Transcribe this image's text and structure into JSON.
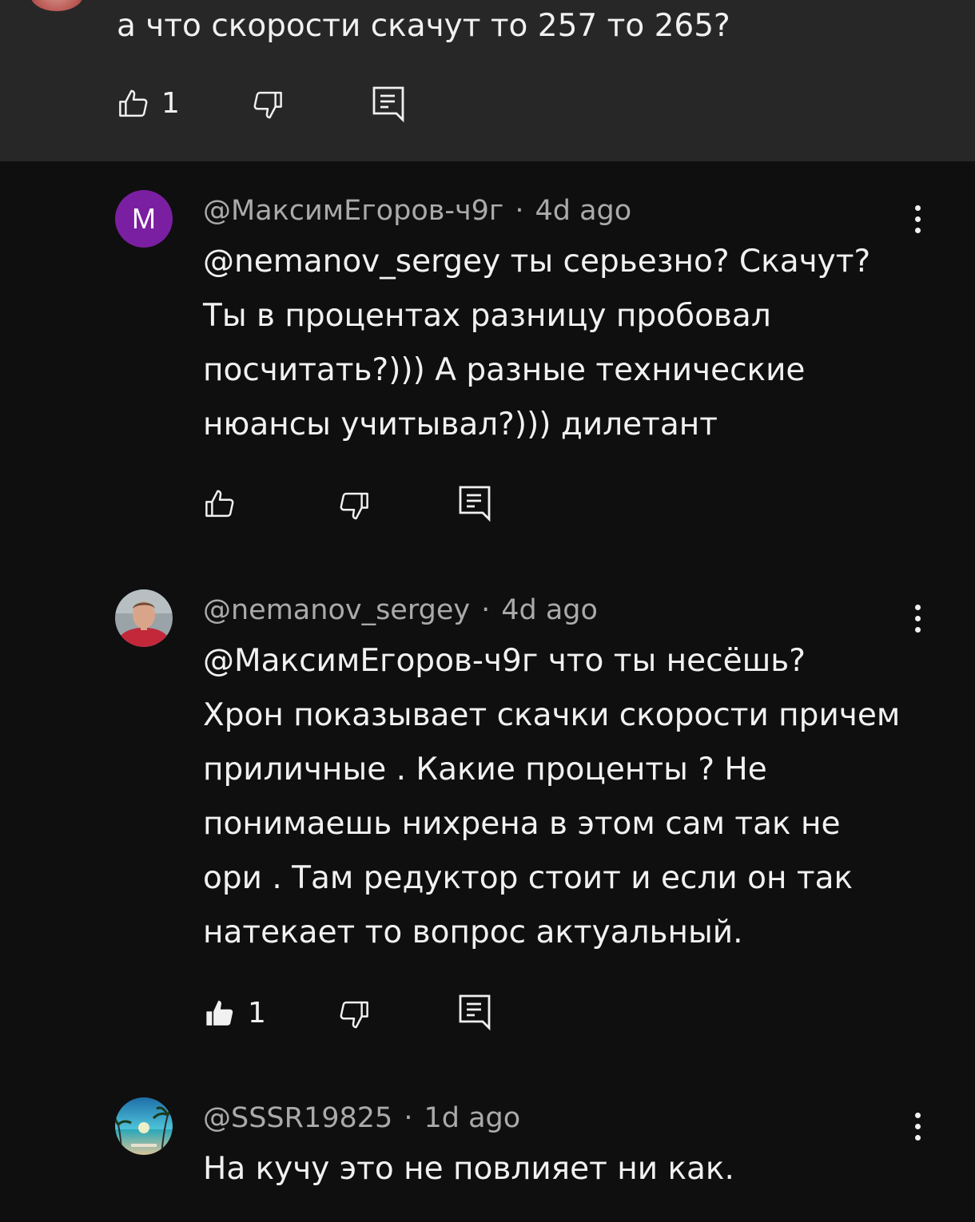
{
  "parent": {
    "text": "а что скорости скачут то 257 то 265?",
    "likes": "1"
  },
  "comments": [
    {
      "avatar_letter": "M",
      "avatar_color": "#7b1fa2",
      "author": "@МаксимЕгоров-ч9г",
      "separator": "·",
      "time": "4d ago",
      "lines": [
        "@nemanov_sergey ты серьезно? Скачут?",
        "Ты в процентах разницу пробовал",
        "посчитать?))) А разные технические",
        "нюансы учитывал?))) дилетант"
      ],
      "likes": "",
      "liked": false
    },
    {
      "avatar_icon": "user-photo",
      "author": "@nemanov_sergey",
      "separator": "·",
      "time": "4d ago",
      "lines": [
        "@МаксимЕгоров-ч9г  что ты несёшь?",
        "Хрон показывает скачки скорости причем",
        "приличные . Какие проценты ? Не",
        "понимаешь нихрена в этом сам так не",
        "ори . Там редуктор стоит и если он так",
        "натекает то вопрос актуальный."
      ],
      "likes": "1",
      "liked": true
    },
    {
      "avatar_icon": "beach-photo",
      "author": "@SSSR19825",
      "separator": "·",
      "time": "1d ago",
      "lines": [
        "На кучу это не повлияет ни как."
      ]
    }
  ]
}
